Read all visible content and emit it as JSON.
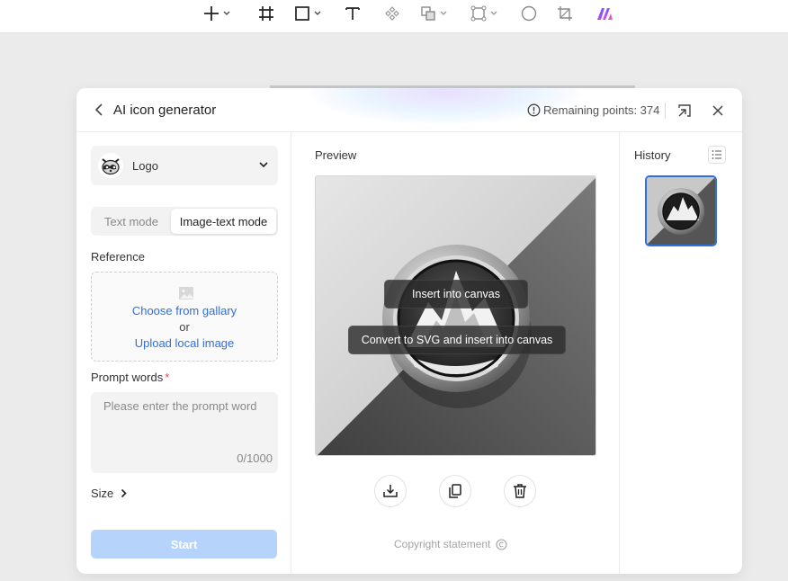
{
  "toolbar": {
    "tools": [
      "add-icon",
      "frame-icon",
      "rectangle-icon",
      "text-icon",
      "component-icon",
      "boolean-icon",
      "path-icon",
      "ellipse-icon",
      "crop-icon",
      "ai-logo-icon"
    ]
  },
  "dialog": {
    "title": "AI icon generator",
    "remaining_points": "Remaining points: 374"
  },
  "left": {
    "style_label": "Logo",
    "modes": {
      "text": "Text mode",
      "image_text": "Image-text mode",
      "active": "image_text"
    },
    "reference_label": "Reference",
    "choose_gallery": "Choose from gallary",
    "or": "or",
    "upload_local": "Upload local image",
    "prompt_label": "Prompt words",
    "required_mark": "*",
    "prompt_placeholder": "Please enter the prompt word",
    "prompt_value": "",
    "prompt_count": "0/1000",
    "size_label": "Size",
    "start_label": "Start"
  },
  "middle": {
    "preview_label": "Preview",
    "insert_label": "Insert into canvas",
    "convert_label": "Convert to SVG and insert into canvas",
    "actions": [
      "download-icon",
      "copy-icon",
      "delete-icon"
    ],
    "copyright_label": "Copyright statement"
  },
  "right": {
    "history_label": "History"
  },
  "colors": {
    "accent": "#2f6fe0",
    "start_disabled": "#b6d3fb",
    "required": "#e5484d"
  }
}
